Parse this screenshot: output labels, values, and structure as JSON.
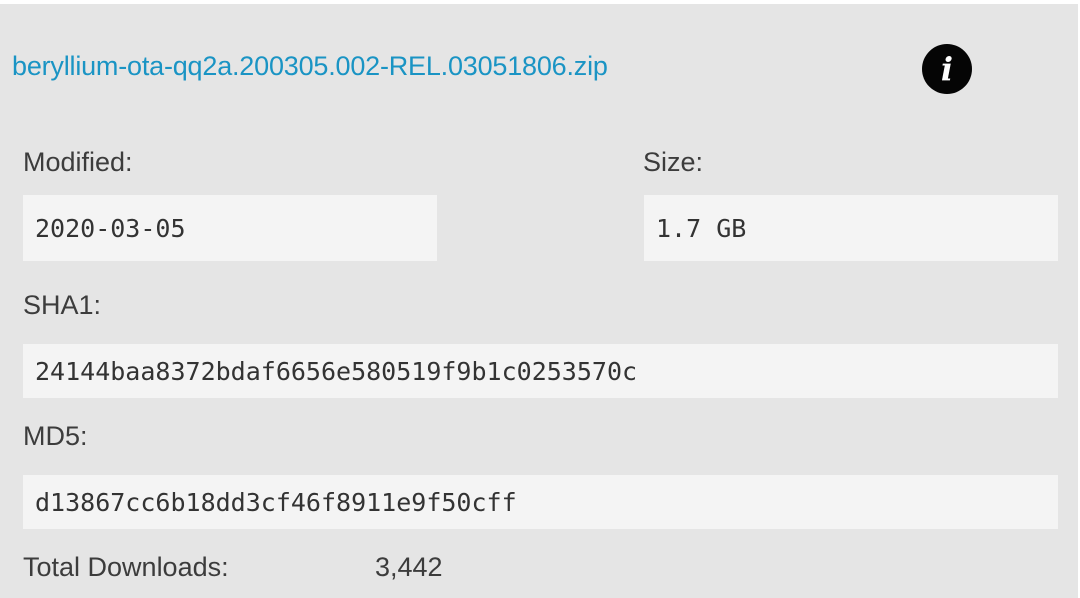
{
  "file": {
    "name": "beryllium-ota-qq2a.200305.002-REL.03051806.zip",
    "info_icon": "info-icon"
  },
  "modified": {
    "label": "Modified:",
    "value": "2020-03-05"
  },
  "size": {
    "label": "Size:",
    "value": "1.7 GB"
  },
  "sha1": {
    "label": "SHA1:",
    "value": "24144baa8372bdaf6656e580519f9b1c0253570c"
  },
  "md5": {
    "label": "MD5:",
    "value": "d13867cc6b18dd3cf46f8911e9f50cff"
  },
  "downloads": {
    "label": "Total Downloads:",
    "value": "3,442"
  },
  "colors": {
    "link": "#1a94c4",
    "card_background": "#e5e5e5",
    "field_background": "#f4f4f4",
    "icon_background": "#050505"
  }
}
